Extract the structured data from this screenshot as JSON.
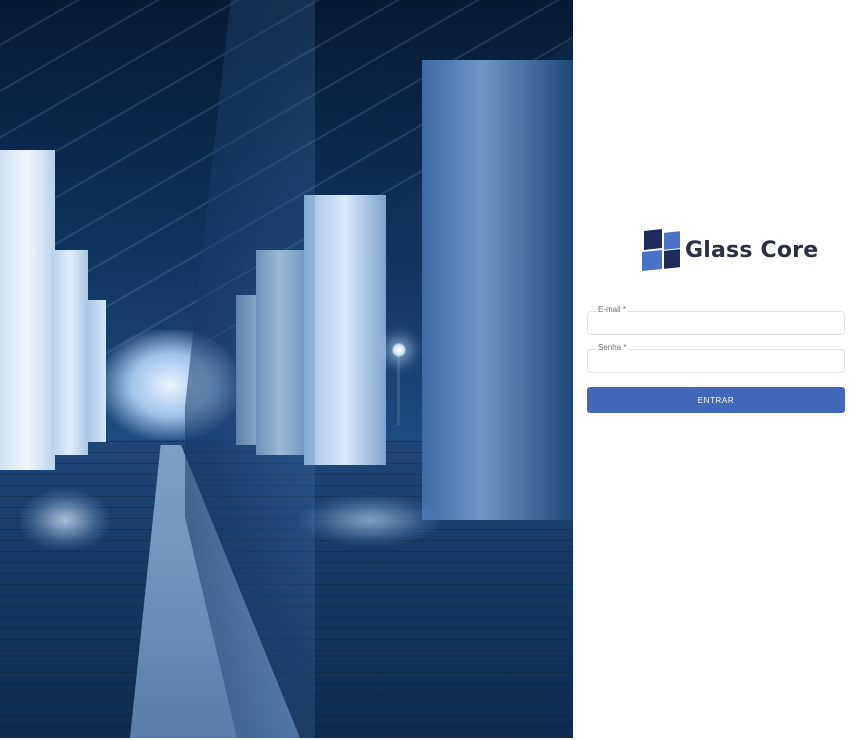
{
  "hero": {
    "image_alt": "Modern glass building corridor with columns at night"
  },
  "brand": {
    "name": "Glass Core",
    "logo_icon": "glass-core-logo-icon",
    "colors": {
      "dark": "#1e2a5c",
      "light": "#4a72c7"
    }
  },
  "login": {
    "email": {
      "label": "E-mail *",
      "value": "",
      "placeholder": ""
    },
    "password": {
      "label": "Senha *",
      "value": "",
      "placeholder": ""
    },
    "submit_label": "ENTRAR",
    "accent": "#4167b8"
  }
}
